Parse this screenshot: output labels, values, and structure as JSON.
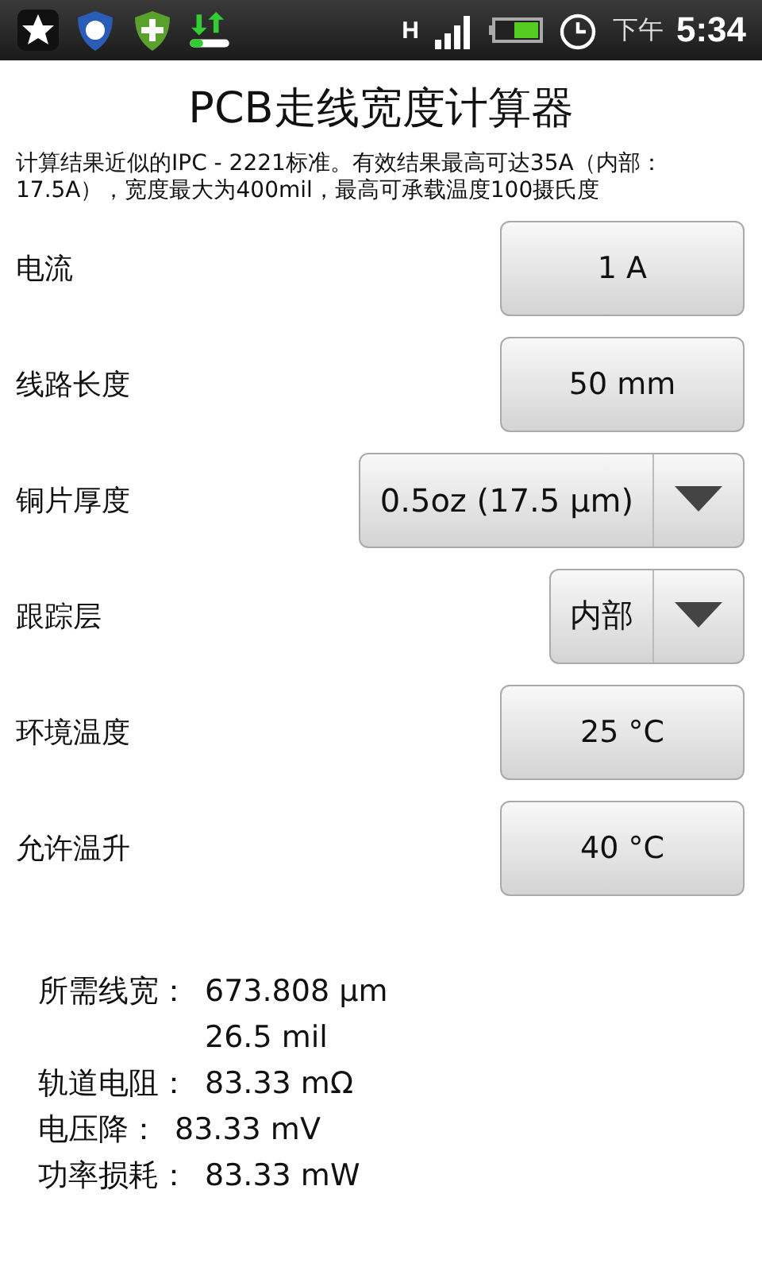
{
  "status_bar": {
    "network_type": "H",
    "ampm": "下午",
    "time": "5:34"
  },
  "title": "PCB走线宽度计算器",
  "description": "计算结果近似的IPC - 2221标准。有效结果最高可达35A（内部：17.5A），宽度最大为400mil，最高可承载温度100摄氏度",
  "fields": [
    {
      "label": "电流",
      "kind": "button",
      "value": "1 A"
    },
    {
      "label": "线路长度",
      "kind": "button",
      "value": "50 mm"
    },
    {
      "label": "铜片厚度",
      "kind": "spinner",
      "value": "0.5oz (17.5 µm)"
    },
    {
      "label": "跟踪层",
      "kind": "spinner",
      "value": "内部"
    },
    {
      "label": "环境温度",
      "kind": "button",
      "value": "25 °C"
    },
    {
      "label": "允许温升",
      "kind": "button",
      "value": "40 °C"
    }
  ],
  "results": [
    {
      "label": "所需线宽：",
      "values": [
        "673.808 µm",
        "26.5 mil"
      ]
    },
    {
      "label": "轨道电阻：",
      "values": [
        "83.33 mΩ"
      ]
    },
    {
      "label": "电压降：",
      "values": [
        "83.33 mV"
      ]
    },
    {
      "label": "功率损耗：",
      "values": [
        "83.33 mW"
      ]
    }
  ]
}
